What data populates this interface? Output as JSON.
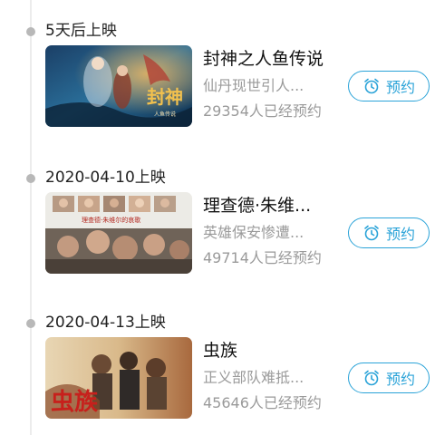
{
  "movies": [
    {
      "date": "5天后上映",
      "title": "封神之人鱼传说",
      "subtitle": "仙丹现世引人...",
      "count": "29354人已经预约",
      "button": "预约",
      "poster_text": "封神",
      "poster_subtext": "人鱼传说"
    },
    {
      "date": "2020-04-10上映",
      "title": "理查德·朱维...",
      "subtitle": "英雄保安惨遭...",
      "count": "49714人已经预约",
      "button": "预约",
      "poster_text": "理查德·朱维尔的哀歌"
    },
    {
      "date": "2020-04-13上映",
      "title": "虫族",
      "subtitle": "正义部队难抵...",
      "count": "45646人已经预约",
      "button": "预约",
      "poster_text": "虫族"
    }
  ],
  "colors": {
    "accent": "#2aa3d8",
    "muted_text": "#9a9a9a",
    "timeline": "#ececec",
    "dot": "#b8b8b8"
  },
  "icons": {
    "reserve": "alarm-clock-icon"
  }
}
